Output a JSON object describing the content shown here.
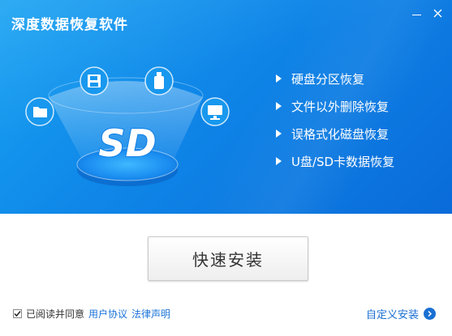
{
  "window": {
    "title": "深度数据恢复软件",
    "minimize_icon": "minimize-icon",
    "close_icon": "close-icon"
  },
  "illustration": {
    "logo_text": "SD",
    "icons": [
      "folder-icon",
      "save-disk-icon",
      "usb-drive-icon",
      "monitor-icon"
    ]
  },
  "features": [
    "硬盘分区恢复",
    "文件以外删除恢复",
    "误格式化磁盘恢复",
    "U盘/SD卡数据恢复"
  ],
  "install_button": "快速安装",
  "agreement": {
    "checked": true,
    "text": "已阅读并同意",
    "user_agreement_link": "用户协议",
    "legal_link": "法律声明"
  },
  "custom_install": "自定义安装",
  "colors": {
    "banner": "#0f86e8",
    "link": "#1a73d9"
  }
}
